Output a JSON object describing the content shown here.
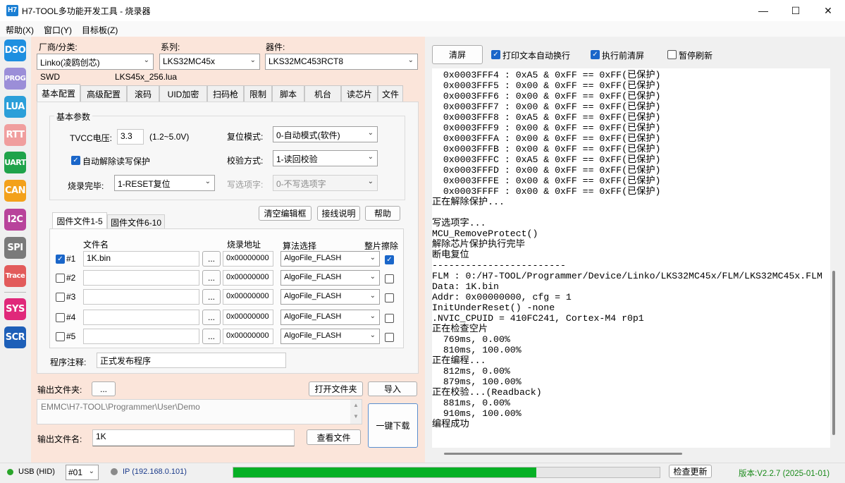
{
  "window": {
    "icon_text": "H7",
    "title": "H7-TOOL多功能开发工具 - 烧录器"
  },
  "menu": [
    "帮助(X)",
    "窗口(Y)",
    "目标板(Z)"
  ],
  "nav": [
    {
      "label": "DSO",
      "color": "#1e8fe0"
    },
    {
      "label": "PROG",
      "color": "#9b8ed8"
    },
    {
      "label": "LUA",
      "color": "#2b9fd9"
    },
    {
      "label": "RTT",
      "color": "#f09e9e"
    },
    {
      "label": "UART",
      "color": "#1fa34a"
    },
    {
      "label": "CAN",
      "color": "#f3a11b"
    },
    {
      "label": "I2C",
      "color": "#b8439b"
    },
    {
      "label": "SPI",
      "color": "#7a7a7a"
    },
    {
      "label": "Trace",
      "color": "#e25b5b"
    },
    {
      "label": "SYS",
      "color": "#e0287a"
    },
    {
      "label": "SCR",
      "color": "#1d5fb8"
    }
  ],
  "device": {
    "vendor_label": "厂商/分类:",
    "vendor_value": "Linko(凌鸥创芯)",
    "series_label": "系列:",
    "series_value": "LKS32MC45x",
    "part_label": "器件:",
    "part_value": "LKS32MC453RCT8",
    "interface": "SWD",
    "lua_file": "LKS45x_256.lua"
  },
  "tabs": [
    "基本配置",
    "高级配置",
    "滚码",
    "UID加密",
    "扫码枪",
    "限制",
    "脚本",
    "机台",
    "读芯片",
    "文件"
  ],
  "basic": {
    "group_title": "基本参数",
    "tvcc_label": "TVCC电压:",
    "tvcc_value": "3.3",
    "tvcc_range": "(1.2~5.0V)",
    "reset_label": "复位模式:",
    "reset_value": "0-自动模式(软件)",
    "auto_unprotect_label": "自动解除读写保护",
    "verify_label": "校验方式:",
    "verify_value": "1-读回校验",
    "finish_label": "烧录完毕:",
    "finish_value": "1-RESET复位",
    "option_label": "写选项字:",
    "option_value": "0-不写选项字",
    "clear_btn": "清空编辑框",
    "wiring_btn": "接线说明",
    "help_btn": "帮助"
  },
  "files": {
    "subtabs": [
      "固件文件1-5",
      "固件文件6-10"
    ],
    "col_name": "文件名",
    "col_addr": "烧录地址",
    "col_algo": "算法选择",
    "col_erase": "整片擦除",
    "browse": "...",
    "rows": [
      {
        "id": "#1",
        "checked": true,
        "file": "1K.bin",
        "addr": "0x00000000",
        "algo": "AlgoFile_FLASH",
        "erase": true
      },
      {
        "id": "#2",
        "checked": false,
        "file": "",
        "addr": "0x00000000",
        "algo": "AlgoFile_FLASH",
        "erase": false
      },
      {
        "id": "#3",
        "checked": false,
        "file": "",
        "addr": "0x00000000",
        "algo": "AlgoFile_FLASH",
        "erase": false
      },
      {
        "id": "#4",
        "checked": false,
        "file": "",
        "addr": "0x00000000",
        "algo": "AlgoFile_FLASH",
        "erase": false
      },
      {
        "id": "#5",
        "checked": false,
        "file": "",
        "addr": "0x00000000",
        "algo": "AlgoFile_FLASH",
        "erase": false
      }
    ],
    "note_label": "程序注释:",
    "note_value": "正式发布程序"
  },
  "output": {
    "folder_label": "输出文件夹:",
    "folder_btn": "...",
    "open_folder_btn": "打开文件夹",
    "import_btn": "导入",
    "path": "EMMC\\H7-TOOL\\Programmer\\User\\Demo",
    "name_label": "输出文件名:",
    "name_value": "1K",
    "view_btn": "查看文件",
    "download_btn": "一键下载"
  },
  "log_toolbar": {
    "clear_btn": "清屏",
    "wrap_label": "打印文本自动换行",
    "wrap_checked": true,
    "preclear_label": "执行前清屏",
    "preclear_checked": true,
    "pause_label": "暂停刷新",
    "pause_checked": false
  },
  "log_lines": [
    "  0x0003FFF4 : 0xA5 & 0xFF == 0xFF(已保护)",
    "  0x0003FFF5 : 0x00 & 0xFF == 0xFF(已保护)",
    "  0x0003FFF6 : 0x00 & 0xFF == 0xFF(已保护)",
    "  0x0003FFF7 : 0x00 & 0xFF == 0xFF(已保护)",
    "  0x0003FFF8 : 0xA5 & 0xFF == 0xFF(已保护)",
    "  0x0003FFF9 : 0x00 & 0xFF == 0xFF(已保护)",
    "  0x0003FFFA : 0x00 & 0xFF == 0xFF(已保护)",
    "  0x0003FFFB : 0x00 & 0xFF == 0xFF(已保护)",
    "  0x0003FFFC : 0xA5 & 0xFF == 0xFF(已保护)",
    "  0x0003FFFD : 0x00 & 0xFF == 0xFF(已保护)",
    "  0x0003FFFE : 0x00 & 0xFF == 0xFF(已保护)",
    "  0x0003FFFF : 0x00 & 0xFF == 0xFF(已保护)",
    "正在解除保护...",
    "",
    "写选项字...",
    "MCU_RemoveProtect()",
    "解除芯片保护执行完毕",
    "断电复位",
    "------------------------",
    "FLM : 0:/H7-TOOL/Programmer/Device/Linko/LKS32MC45x/FLM/LKS32MC45x.FLM",
    "Data: 1K.bin",
    "Addr: 0x00000000, cfg = 1",
    "InitUnderReset() -none",
    ".NVIC_CPUID = 410FC241, Cortex-M4 r0p1",
    "正在检查空片",
    "  769ms, 0.00%",
    "  810ms, 100.00%",
    "正在编程...",
    "  812ms, 0.00%",
    "  879ms, 100.00%",
    "正在校验...(Readback)",
    "  881ms, 0.00%",
    "  910ms, 100.00%",
    "编程成功"
  ],
  "status": {
    "usb": "USB (HID)",
    "usb_color": "#2aa52a",
    "port": "#01",
    "ip": "IP (192.168.0.101)",
    "ip_color": "#8a8a8a",
    "progress": 0.71,
    "progress_color": "#06b025",
    "update_btn": "检查更新",
    "version": "版本:V2.2.7 (2025-01-01)",
    "version_color": "#1a8a1a"
  }
}
